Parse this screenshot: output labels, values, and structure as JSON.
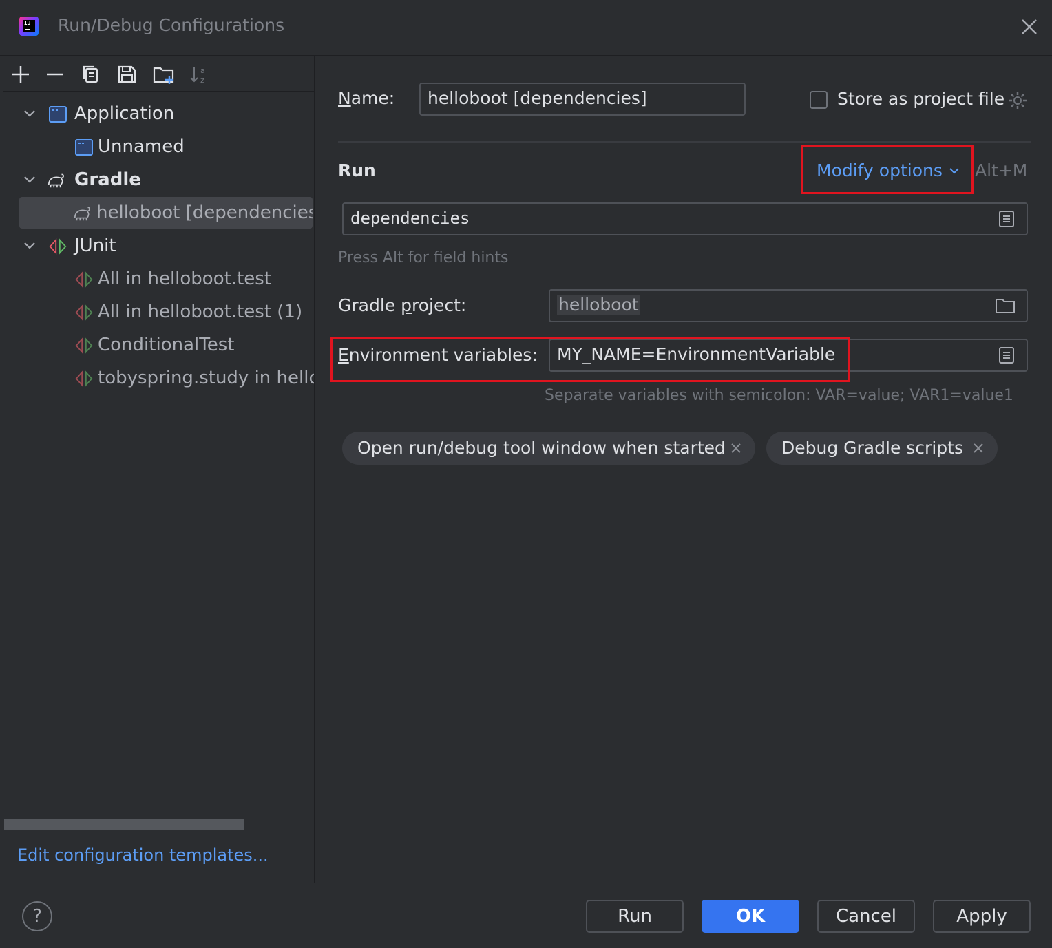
{
  "window": {
    "title": "Run/Debug Configurations"
  },
  "toolbar": {
    "icons": [
      "add-icon",
      "remove-icon",
      "copy-icon",
      "save-icon",
      "new-folder-icon",
      "sort-icon"
    ]
  },
  "tree": {
    "application_group": "Application",
    "application_item": "Unnamed",
    "gradle_group": "Gradle",
    "gradle_item": "helloboot [dependencies]",
    "junit_group": "JUnit",
    "junit_items": [
      "All in helloboot.test",
      "All in helloboot.test (1)",
      "ConditionalTest",
      "tobyspring.study in hellob"
    ]
  },
  "edit_templates_link": "Edit configuration templates...",
  "form": {
    "name_label_u": "N",
    "name_label_rest": "ame:",
    "name_value": "helloboot [dependencies]",
    "store_as_project_file": "Store as project file",
    "run_section": "Run",
    "modify_options": "Modify options",
    "modify_shortcut": "Alt+M",
    "tasks_value": "dependencies",
    "field_hint": "Press Alt for field hints",
    "gradle_project_label_pre": "Gradle ",
    "gradle_project_label_u": "p",
    "gradle_project_label_post": "roject:",
    "gradle_project_value": "helloboot",
    "env_label_u": "E",
    "env_label_rest": "nvironment variables:",
    "env_value": "MY_NAME=EnvironmentVariable",
    "env_hint": "Separate variables with semicolon: VAR=value; VAR1=value1",
    "chips": [
      "Open run/debug tool window when started",
      "Debug Gradle scripts"
    ]
  },
  "buttons": {
    "run": "Run",
    "ok": "OK",
    "cancel": "Cancel",
    "apply": "Apply",
    "help": "?"
  },
  "colors": {
    "accent": "#3574f0",
    "link": "#5c9df5",
    "highlight_box": "#e0141f",
    "background": "#2b2d30"
  }
}
